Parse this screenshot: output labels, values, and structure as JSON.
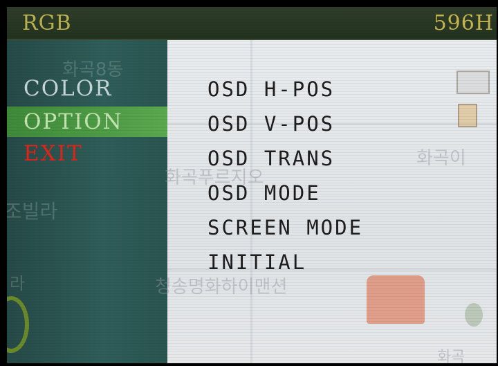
{
  "top_bar": {
    "mode_label": "RGB",
    "frequency_label": "596H"
  },
  "left_menu": {
    "items": [
      {
        "label": "COLOR",
        "state": "normal"
      },
      {
        "label": "OPTION",
        "state": "selected"
      },
      {
        "label": "EXIT",
        "state": "exit"
      }
    ]
  },
  "option_submenu": {
    "items": [
      {
        "label": "OSD H-POS"
      },
      {
        "label": "OSD V-POS"
      },
      {
        "label": "OSD TRANS"
      },
      {
        "label": "OSD MODE"
      },
      {
        "label": "SCREEN MODE"
      },
      {
        "label": "INITIAL"
      }
    ]
  },
  "background_map": {
    "labels": [
      "화곡8동",
      "화곡이",
      "화곡푸르지오",
      "조빌라",
      "라",
      "청송명화하이맨션",
      "화곡"
    ]
  },
  "colors": {
    "accent_selected": "#4f9e46",
    "exit_red": "#e02418",
    "status_yellow": "#c8b74e"
  }
}
